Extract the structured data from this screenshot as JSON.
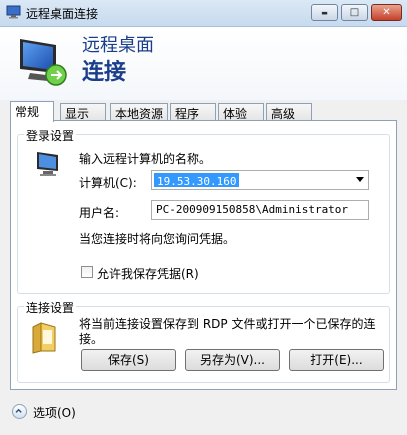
{
  "window": {
    "title": "远程桌面连接",
    "minimize_glyph": "▬",
    "maximize_glyph": "□",
    "close_glyph": "✕"
  },
  "header": {
    "line1": "远程桌面",
    "line2": "连接",
    "icon": "remote-desktop-monitor-icon"
  },
  "tabs": [
    {
      "label": "常规",
      "active": true
    },
    {
      "label": "显示",
      "active": false
    },
    {
      "label": "本地资源",
      "active": false
    },
    {
      "label": "程序",
      "active": false
    },
    {
      "label": "体验",
      "active": false
    },
    {
      "label": "高级",
      "active": false
    }
  ],
  "login": {
    "group_title": "登录设置",
    "prompt": "输入远程计算机的名称。",
    "computer_label": "计算机(C):",
    "computer_value": "19.53.30.160",
    "username_label": "用户名:",
    "username_value": "PC-200909150858\\Administrator",
    "note": "当您连接时将向您询问凭据。",
    "save_credentials_label": "允许我保存凭据(R)",
    "save_credentials_checked": false
  },
  "connection": {
    "group_title": "连接设置",
    "description": "将当前连接设置保存到 RDP 文件或打开一个已保存的连接。",
    "save_label": "保存(S)",
    "save_as_label": "另存为(V)...",
    "open_label": "打开(E)..."
  },
  "footer": {
    "options_label": "选项(O)"
  }
}
